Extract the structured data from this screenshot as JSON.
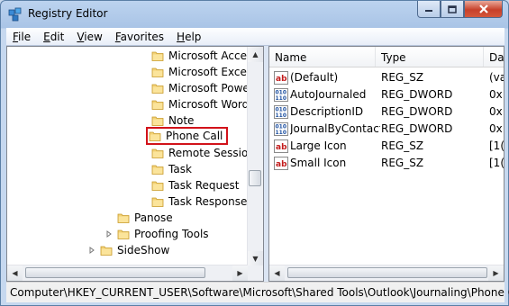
{
  "window": {
    "title": "Registry Editor",
    "close_label": "x"
  },
  "menu": [
    "File",
    "Edit",
    "View",
    "Favorites",
    "Help"
  ],
  "tree": {
    "items": [
      {
        "label": "Microsoft Access"
      },
      {
        "label": "Microsoft Excel"
      },
      {
        "label": "Microsoft Power"
      },
      {
        "label": "Microsoft Word"
      },
      {
        "label": "Note"
      },
      {
        "label": "Phone Call",
        "selected": true
      },
      {
        "label": "Remote Session"
      },
      {
        "label": "Task"
      },
      {
        "label": "Task Request"
      },
      {
        "label": "Task Response"
      },
      {
        "label": "Panose"
      },
      {
        "label": "Proofing Tools"
      },
      {
        "label": "SideShow"
      }
    ]
  },
  "list": {
    "columns": [
      "Name",
      "Type",
      "Da"
    ],
    "rows": [
      {
        "name": "(Default)",
        "type": "REG_SZ",
        "data": "(va",
        "icon": "string-value-icon"
      },
      {
        "name": "AutoJournaled",
        "type": "REG_DWORD",
        "data": "0x",
        "icon": "binary-value-icon"
      },
      {
        "name": "DescriptionID",
        "type": "REG_DWORD",
        "data": "0x",
        "icon": "binary-value-icon"
      },
      {
        "name": "JournalByContact",
        "type": "REG_DWORD",
        "data": "0x",
        "icon": "binary-value-icon"
      },
      {
        "name": "Large Icon",
        "type": "REG_SZ",
        "data": "[1(",
        "icon": "string-value-icon"
      },
      {
        "name": "Small Icon",
        "type": "REG_SZ",
        "data": "[1(",
        "icon": "string-value-icon"
      }
    ]
  },
  "status": {
    "path": "Computer\\HKEY_CURRENT_USER\\Software\\Microsoft\\Shared Tools\\Outlook\\Journaling\\Phone Call"
  }
}
